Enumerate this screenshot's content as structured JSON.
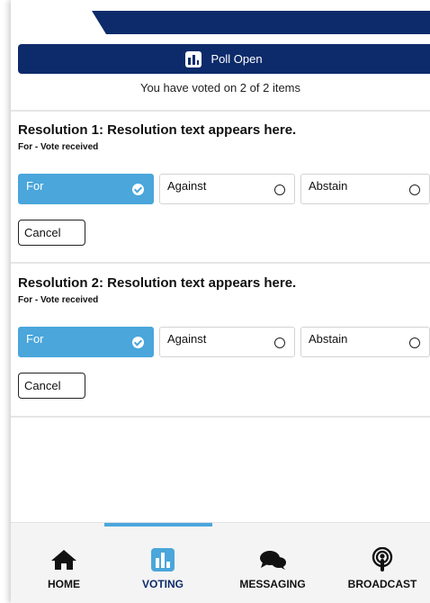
{
  "banner": {
    "title": "Poll Open",
    "icon": "poll-chart-icon"
  },
  "status": "You have voted on 2 of 2 items",
  "resolutions": [
    {
      "title": "Resolution 1: Resolution text appears here.",
      "vote_status": "For - Vote received",
      "options": [
        {
          "label": "For",
          "selected": true
        },
        {
          "label": "Against",
          "selected": false
        },
        {
          "label": "Abstain",
          "selected": false
        }
      ],
      "cancel_label": "Cancel"
    },
    {
      "title": "Resolution 2: Resolution text appears here.",
      "vote_status": "For - Vote received",
      "options": [
        {
          "label": "For",
          "selected": true
        },
        {
          "label": "Against",
          "selected": false
        },
        {
          "label": "Abstain",
          "selected": false
        }
      ],
      "cancel_label": "Cancel"
    }
  ],
  "nav": [
    {
      "label": "HOME",
      "icon": "home-icon",
      "active": false
    },
    {
      "label": "VOTING",
      "icon": "bar-chart-icon",
      "active": true
    },
    {
      "label": "MESSAGING",
      "icon": "chat-bubbles-icon",
      "active": false
    },
    {
      "label": "BROADCAST",
      "icon": "podcast-icon",
      "active": false
    }
  ],
  "colors": {
    "navy": "#0d2b6b",
    "accent": "#4aa6db",
    "nav_bg": "#f4f4f4"
  }
}
